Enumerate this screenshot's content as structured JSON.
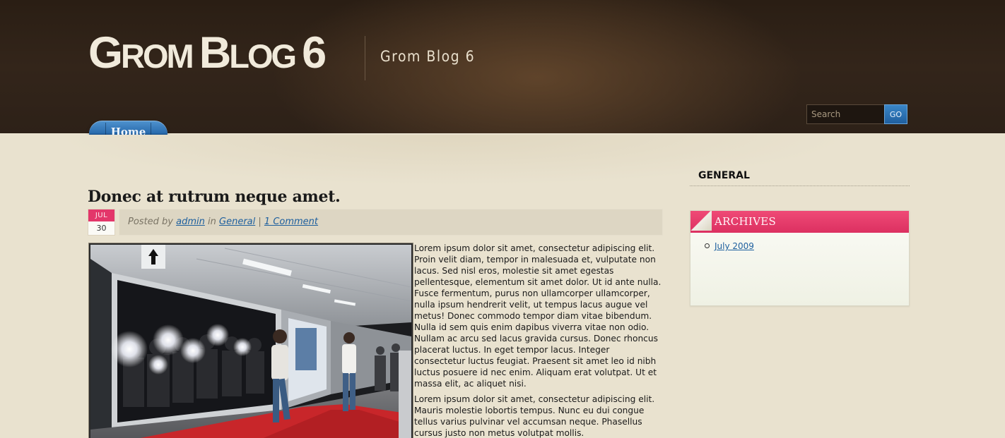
{
  "site": {
    "logo_first_initial": "G",
    "logo_first_rest": "ROM",
    "logo_second_initial": "B",
    "logo_second_rest": "LOG",
    "logo_number": "6",
    "tagline": "Grom Blog 6"
  },
  "search": {
    "placeholder": "Search",
    "button_label": "GO"
  },
  "nav": {
    "items": [
      {
        "label": "Home"
      }
    ]
  },
  "post": {
    "title": "Donec at rutrum neque amet.",
    "date_month": "JUL",
    "date_day": "30",
    "meta_posted_by": "Posted by",
    "author": "admin",
    "meta_in": "in",
    "category": "General",
    "meta_separator": "|",
    "comments": "1 Comment",
    "paragraphs": [
      "Lorem ipsum dolor sit amet, consectetur adipiscing elit. Proin velit diam, tempor in malesuada et, vulputate non lacus. Sed nisl eros, molestie sit amet egestas pellentesque, elementum sit amet dolor. Ut id ante nulla. Fusce fermentum, purus non ullamcorper ullamcorper, nulla ipsum hendrerit velit, ut tempus lacus augue vel metus! Donec commodo tempor diam vitae bibendum. Nulla id sem quis enim dapibus viverra vitae non odio. Nullam ac arcu sed lacus gravida cursus. Donec rhoncus placerat luctus. In eget tempor lacus. Integer consectetur luctus feugiat. Praesent sit amet leo id nibh luctus posuere id nec enim. Aliquam erat volutpat. Ut et massa elit, ac aliquet nisi.",
      "Lorem ipsum dolor sit amet, consectetur adipiscing elit. Mauris molestie lobortis tempus. Nunc eu dui congue tellus varius pulvinar vel accumsan neque. Phasellus cursus justo non metus volutpat mollis."
    ]
  },
  "sidebar": {
    "general_heading": "GENERAL",
    "archives_heading": "ARCHIVES",
    "archives_items": [
      {
        "label": "July 2009"
      }
    ]
  },
  "colors": {
    "header_bg": "#2d2118",
    "content_bg": "#e9e2cf",
    "accent_pink": "#e3366a",
    "nav_blue": "#2a6cae",
    "link_blue": "#1d5f9e"
  },
  "icons": {
    "post_image": "photo-subway-red-carpet-photographers"
  }
}
